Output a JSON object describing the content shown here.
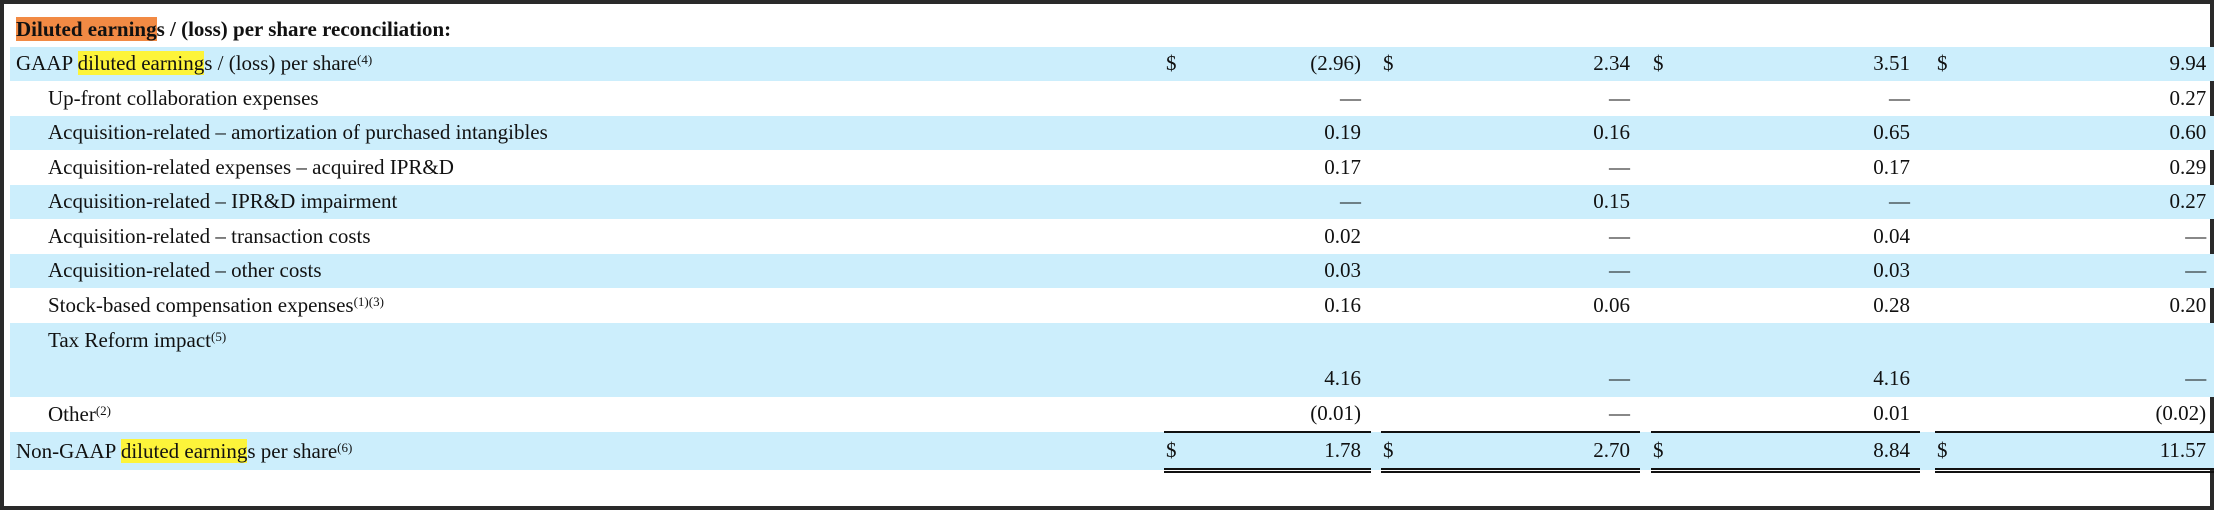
{
  "heading": {
    "highlight_part": "Diluted earning",
    "rest": "s / (loss) per share reconciliation:"
  },
  "gaap_row": {
    "prefix": "GAAP ",
    "highlight_part": "diluted earning",
    "suffix": "s / (loss) per share",
    "footnote": "(4)",
    "currency": "$",
    "values": [
      "(2.96)",
      "2.34",
      "3.51",
      "9.94"
    ]
  },
  "adjustments": [
    {
      "label": "Up-front collaboration expenses",
      "footnote": "",
      "values": [
        "—",
        "—",
        "—",
        "0.27"
      ]
    },
    {
      "label": "Acquisition-related – amortization of purchased intangibles",
      "footnote": "",
      "values": [
        "0.19",
        "0.16",
        "0.65",
        "0.60"
      ]
    },
    {
      "label": "Acquisition-related expenses – acquired IPR&D",
      "footnote": "",
      "values": [
        "0.17",
        "—",
        "0.17",
        "0.29"
      ]
    },
    {
      "label": "Acquisition-related – IPR&D impairment",
      "footnote": "",
      "values": [
        "—",
        "0.15",
        "—",
        "0.27"
      ]
    },
    {
      "label": "Acquisition-related – transaction costs",
      "footnote": "",
      "values": [
        "0.02",
        "—",
        "0.04",
        "—"
      ]
    },
    {
      "label": "Acquisition-related – other costs",
      "footnote": "",
      "values": [
        "0.03",
        "—",
        "0.03",
        "—"
      ]
    },
    {
      "label": "Stock-based compensation expenses",
      "footnote": "(1)(3)",
      "values": [
        "0.16",
        "0.06",
        "0.28",
        "0.20"
      ]
    },
    {
      "label": "Tax Reform impact",
      "footnote": "(5)",
      "values": [
        "4.16",
        "—",
        "4.16",
        "—"
      ]
    },
    {
      "label": "Other",
      "footnote": "(2)",
      "values": [
        "(0.01)",
        "—",
        "0.01",
        "(0.02)"
      ]
    }
  ],
  "non_gaap_row": {
    "prefix": "Non-GAAP ",
    "highlight_part": "diluted earning",
    "suffix": "s per share",
    "footnote": "(6)",
    "currency": "$",
    "values": [
      "1.78",
      "2.70",
      "8.84",
      "11.57"
    ]
  },
  "colors": {
    "row_shade": "#cceefc",
    "highlight_orange": "#f28a44",
    "highlight_yellow": "#fdf43a"
  }
}
